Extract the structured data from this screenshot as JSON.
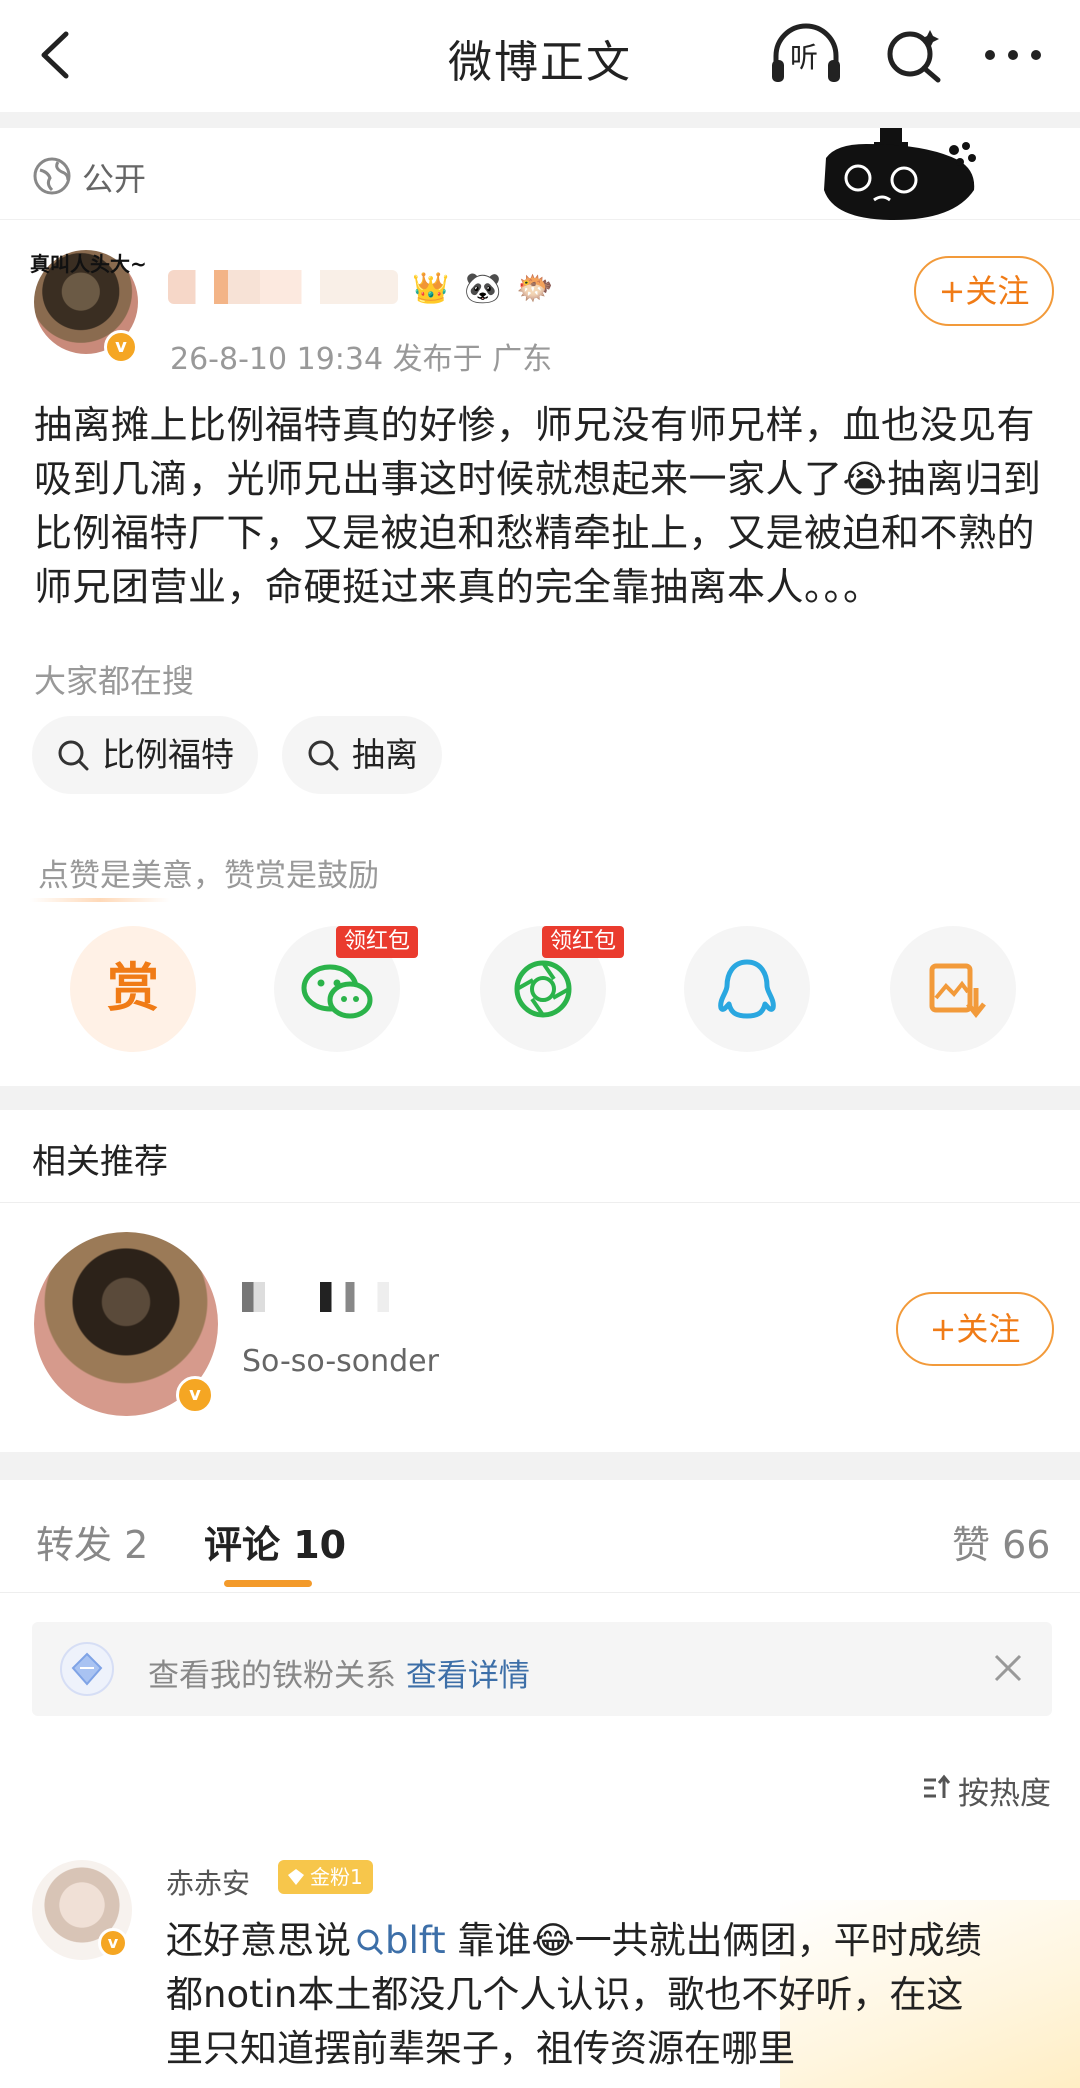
{
  "header": {
    "title": "微博正文",
    "listen_label": "听"
  },
  "visibility": {
    "label": "公开"
  },
  "post": {
    "avatar_caption": "真叫人头大~",
    "meta": "26-8-10 19:34  发布于 广东",
    "follow_label": "+关注",
    "badges": [
      "👑",
      "🐼",
      "🐡"
    ],
    "text_lines": [
      "抽离摊上比例福特真的好惨，师兄没有师兄样，血也没见有",
      "吸到几滴，光师兄出事这时候就想起来一家人了😭抽离归到",
      "比例福特厂下，又是被迫和愁精牵扯上，又是被迫和不熟的",
      "师兄团营业，命硬挺过来真的完全靠抽离本人。。。"
    ]
  },
  "search_suggest": {
    "label": "大家都在搜",
    "chips": [
      "比例福特",
      "抽离"
    ]
  },
  "reward": {
    "tip": "点赞是美意，赞赏是鼓励",
    "reward_label": "赏",
    "redpack_label": "领红包"
  },
  "related": {
    "title": "相关推荐",
    "user_subtitle": "So-so-sonder",
    "follow_label": "+关注"
  },
  "tabs": {
    "repost": "转发 2",
    "comment": "评论 10",
    "like": "赞 66"
  },
  "fans_banner": {
    "text": "查看我的铁粉关系 ",
    "link": "查看详情"
  },
  "sort": {
    "label": "按热度"
  },
  "comment": {
    "name": "赤赤安",
    "badge": "金粉1",
    "line1_before": "还好意思说",
    "mention": "blft",
    "line1_after": " 靠谁😂一共就出俩团，平时成绩",
    "line2": "都notin本土都没几个人认识，歌也不好听，在这",
    "line3": "里只知道摆前辈架子，祖传资源在哪里"
  },
  "colors": {
    "accent": "#f07b16",
    "link": "#3d6fa8",
    "redpack": "#ea3b2e",
    "wechat": "#2bb34a",
    "qq": "#2aa7e0"
  }
}
